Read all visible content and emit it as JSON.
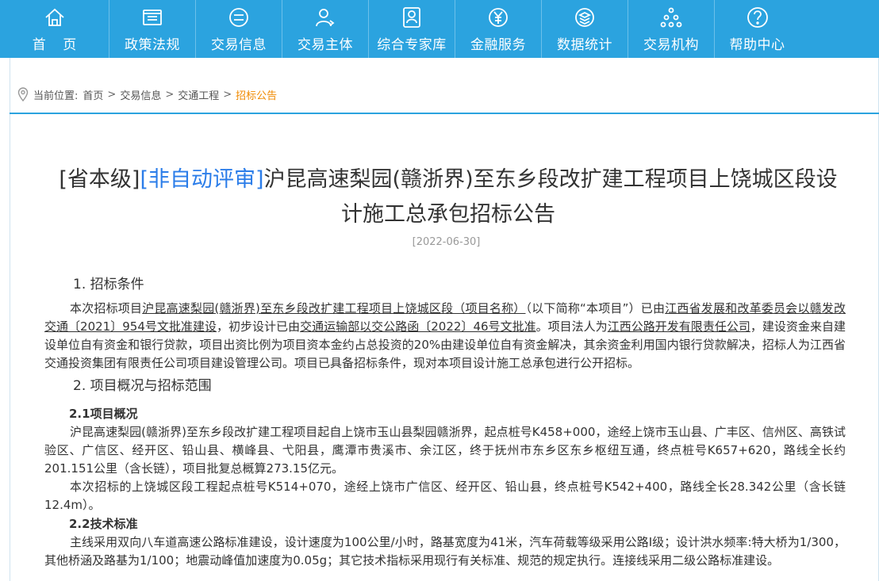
{
  "nav": {
    "items": [
      {
        "label": "首 页",
        "icon": "home-icon"
      },
      {
        "label": "政策法规",
        "icon": "policy-icon"
      },
      {
        "label": "交易信息",
        "icon": "trade-info-icon"
      },
      {
        "label": "交易主体",
        "icon": "user-icon"
      },
      {
        "label": "综合专家库",
        "icon": "expert-icon"
      },
      {
        "label": "金融服务",
        "icon": "finance-icon"
      },
      {
        "label": "数据统计",
        "icon": "data-icon"
      },
      {
        "label": "交易机构",
        "icon": "org-icon"
      },
      {
        "label": "帮助中心",
        "icon": "help-icon"
      }
    ],
    "colors": {
      "bar": "#2ba3df",
      "accent": "#f08a00",
      "tag": "#2b7de9"
    }
  },
  "breadcrumb": {
    "prefix": "当前位置:",
    "items": [
      "首页",
      "交易信息",
      "交通工程"
    ],
    "current": "招标公告",
    "separator": ">"
  },
  "article": {
    "title_tag1": "[省本级]",
    "title_tag2": "[非自动评审]",
    "title_line1_rest": "沪昆高速梨园(赣浙界)至东乡段改扩建工程项目上饶城区段设",
    "title_line2": "计施工总承包招标公告",
    "date": "[2022-06-30]",
    "s1_heading": "1. 招标条件",
    "s1_p1_a": "本次招标项目",
    "s1_p1_u1": "沪昆高速梨园(赣浙界)至东乡段改扩建工程项目上饶城区段（项目名称）",
    "s1_p1_b": "（以下简称“本项目”）已由",
    "s1_p1_u2": "江西省发展和改革委员会以赣发改交通〔2021〕954号文批准建设",
    "s1_p1_c": "，初步设计已由",
    "s1_p1_u3": "交通运输部以交公路函〔2022〕46号文批准",
    "s1_p1_d": "。项目法人为",
    "s1_p1_u4": "江西公路开发有限责任公司",
    "s1_p1_e": "，建设资金来自建设单位自有资金和银行贷款，项目出资比例为项目资本金约占总投资的20%由建设单位自有资金解决，其余资金利用国内银行贷款解决，招标人为江西省交通投资集团有限责任公司项目建设管理公司。项目已具备招标条件，现对本项目设计施工总承包进行公开招标。",
    "s2_heading": "2. 项目概况与招标范围",
    "s21_heading": "2.1项目概况",
    "s21_p1": "沪昆高速梨园(赣浙界)至东乡段改扩建工程项目起自上饶市玉山县梨园赣浙界，起点桩号K458+000，途经上饶市玉山县、广丰区、信州区、高铁试验区、广信区、经开区、铅山县、横峰县、弋阳县，鹰潭市贵溪市、余江区，终于抚州市东乡区东乡枢纽互通，终点桩号K657+620，路线全长约201.151公里（含长链），项目批复总概算273.15亿元。",
    "s21_p2": "本次招标的上饶城区段工程起点桩号K514+070，途经上饶市广信区、经开区、铅山县，终点桩号K542+400，路线全长28.342公里（含长链12.4m）。",
    "s22_heading": "2.2技术标准",
    "s22_p1": "主线采用双向八车道高速公路标准建设，设计速度为100公里/小时，路基宽度为41米，汽车荷载等级采用公路I级；设计洪水频率:特大桥为1/300，其他桥涵及路基为1/100；地震动峰值加速度为0.05g；其它技术指标采用现行有关标准、规范的规定执行。连接线采用二级公路标准建设。"
  }
}
